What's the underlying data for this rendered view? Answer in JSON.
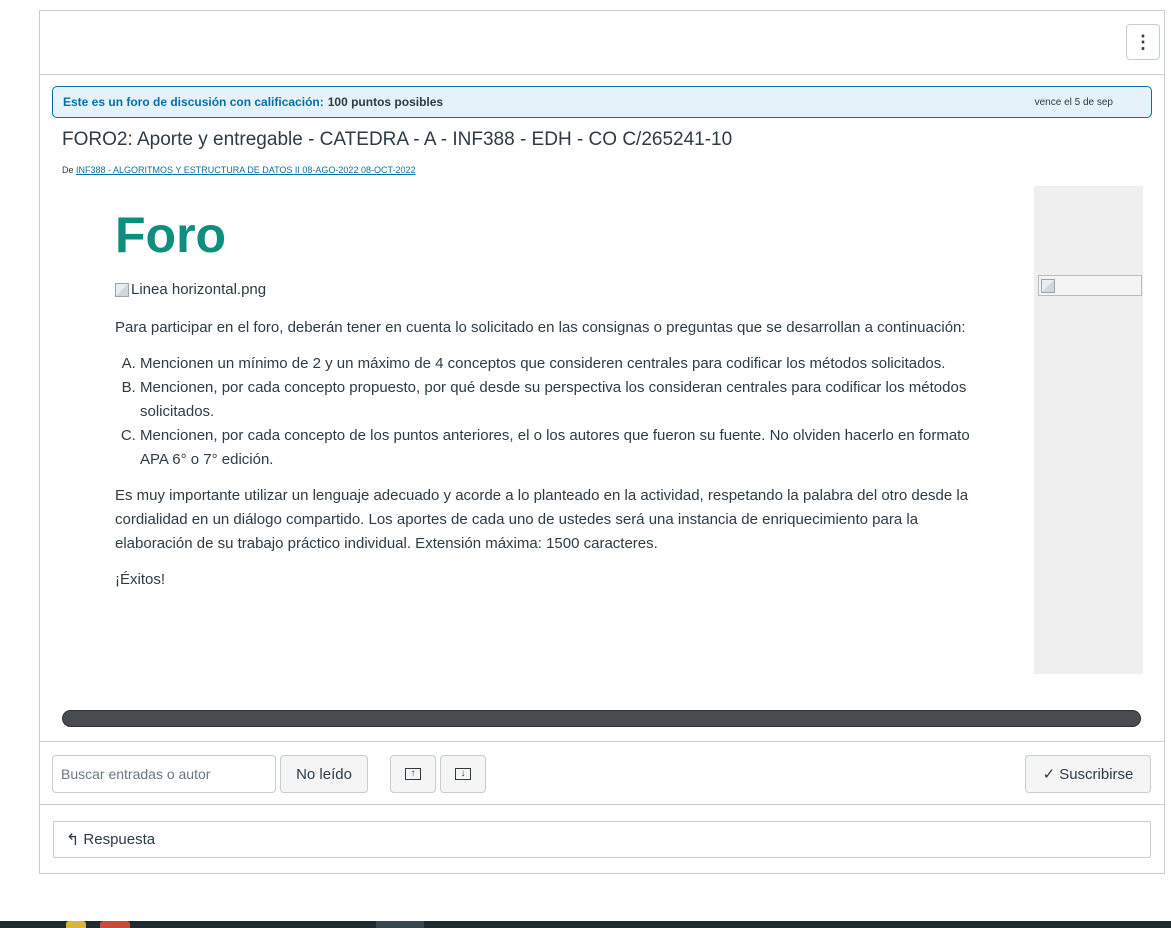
{
  "header": {
    "options_icon": "kebab-vertical-icon",
    "options_label": "⋮"
  },
  "banner": {
    "label": "Este es un foro de discusión con calificación:",
    "points": "100 puntos posibles",
    "due": "vence el 5 de sep"
  },
  "topic": {
    "title": "FORO2: Aporte y entregable - CATEDRA - A - INF388 - EDH - CO C/265241-10",
    "from_prefix": "De",
    "from_link": "INF388 - ALGORITMOS Y ESTRUCTURA DE DATOS II 08-AGO-2022 08-OCT-2022"
  },
  "body": {
    "heading": "Foro",
    "image_alt": "Linea horizontal.png",
    "intro": "Para participar en el foro, deberán tener en cuenta lo solicitado en las consignas o preguntas que se desarrollan a continuación:",
    "items": [
      "Mencionen un mínimo de 2 y un máximo de 4 conceptos que consideren centrales para codificar los métodos solicitados.",
      "Mencionen, por cada concepto propuesto, por qué desde su perspectiva los consideran centrales para codificar los métodos solicitados.",
      "Mencionen, por cada concepto de los puntos anteriores, el o los autores que fueron su fuente. No olviden hacerlo en formato APA 6° o 7° edición."
    ],
    "closing": "Es muy importante utilizar un lenguaje adecuado y acorde a lo planteado en la actividad, respetando la palabra del otro desde la cordialidad en un diálogo compartido. Los aportes de cada uno de ustedes será una instancia de enriquecimiento para la elaboración de su trabajo práctico individual. Extensión máxima: 1500 caracteres.",
    "signoff": "¡Éxitos!"
  },
  "toolbar": {
    "search_placeholder": "Buscar entradas o autor",
    "unread_label": "No leído",
    "expand_icon": "arrow-up-box-icon",
    "collapse_icon": "arrow-down-box-icon",
    "subscribe_label": "Suscribirse",
    "subscribe_icon": "check-icon"
  },
  "reply": {
    "label": "Respuesta",
    "icon": "reply-arrow-icon"
  },
  "colors": {
    "accent_blue": "#0770a3",
    "heading_teal": "#0e8e7f",
    "banner_bg": "#e6f2f9"
  }
}
